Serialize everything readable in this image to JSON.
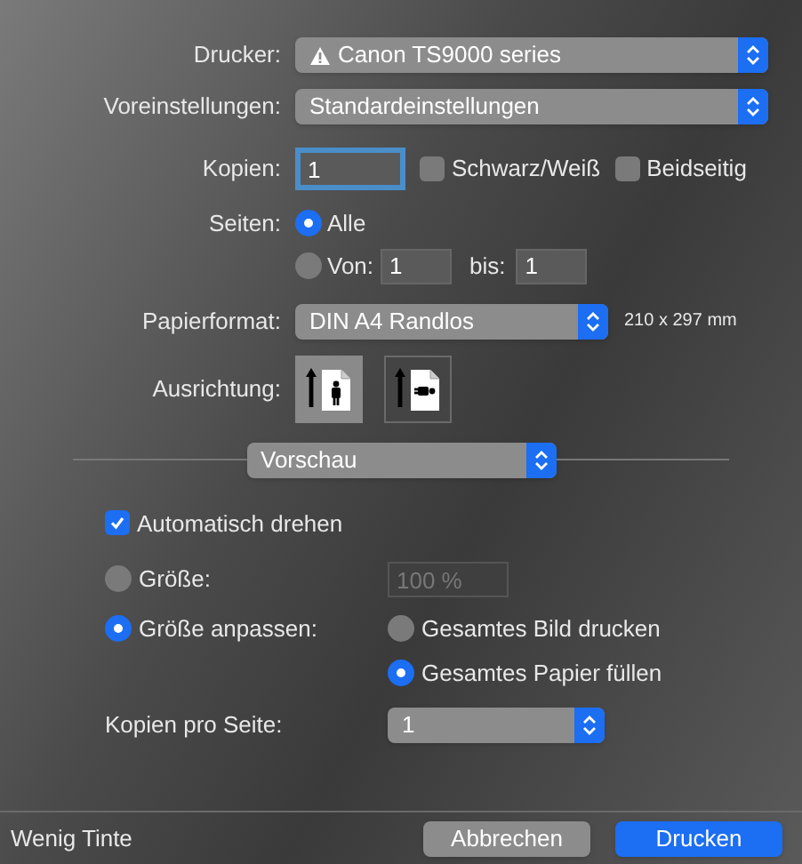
{
  "printer": {
    "label": "Drucker:",
    "value": "Canon TS9000 series",
    "warning": true
  },
  "presets": {
    "label": "Voreinstellungen:",
    "value": "Standardeinstellungen"
  },
  "copies": {
    "label": "Kopien:",
    "value": "1",
    "focused": true
  },
  "options": [
    {
      "label": "Schwarz/Weiß",
      "checked": false
    },
    {
      "label": "Beidseitig",
      "checked": false
    }
  ],
  "pages": {
    "label": "Seiten:",
    "choices": [
      {
        "kind": "all",
        "label": "Alle",
        "selected": true
      },
      {
        "kind": "range",
        "label": "Von:",
        "selected": false,
        "from": "1",
        "to_label": "bis:",
        "to": "1"
      }
    ]
  },
  "paper_size": {
    "label": "Papierformat:",
    "value": "DIN A4 Randlos",
    "dimensions": "210 x 297 mm"
  },
  "orientation": {
    "label": "Ausrichtung:",
    "options": [
      {
        "kind": "portrait",
        "selected": true
      },
      {
        "kind": "landscape",
        "selected": false
      }
    ]
  },
  "section": {
    "value": "Vorschau"
  },
  "auto_rotate": {
    "label": "Automatisch drehen",
    "checked": true
  },
  "scale": {
    "choices": [
      {
        "kind": "size",
        "label": "Größe:",
        "selected": false,
        "value": "100 %",
        "disabled": true
      },
      {
        "kind": "fit",
        "label": "Größe anpassen:",
        "selected": true,
        "sub_choices": [
          {
            "label": "Gesamtes Bild drucken",
            "selected": false
          },
          {
            "label": "Gesamtes Papier füllen",
            "selected": true
          }
        ]
      }
    ]
  },
  "copies_per_page": {
    "label": "Kopien pro Seite:",
    "value": "1"
  },
  "footer": {
    "status": "Wenig Tinte",
    "buttons": [
      {
        "kind": "cancel",
        "label": "Abbrechen"
      },
      {
        "kind": "primary",
        "label": "Drucken"
      }
    ]
  }
}
